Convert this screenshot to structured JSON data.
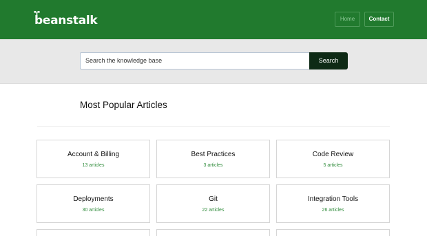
{
  "header": {
    "logo_text": "beanstalk",
    "nav": {
      "home_label": "Home",
      "contact_label": "Contact"
    }
  },
  "search": {
    "placeholder": "Search the knowledge base",
    "button_label": "Search"
  },
  "main": {
    "section_title": "Most Popular Articles",
    "categories": [
      {
        "title": "Account & Billing",
        "count": "13 articles"
      },
      {
        "title": "Best Practices",
        "count": "3 articles"
      },
      {
        "title": "Code Review",
        "count": "5 articles"
      },
      {
        "title": "Deployments",
        "count": "30 articles"
      },
      {
        "title": "Git",
        "count": "22 articles"
      },
      {
        "title": "Integration Tools",
        "count": "26 articles"
      }
    ]
  },
  "colors": {
    "header_green": "#217a2e",
    "search_button": "#0e2a15",
    "count_green": "#2e8b3a",
    "band_gray": "#e8e8e8"
  },
  "icons": {
    "logo": "leaf-sprout-icon"
  }
}
